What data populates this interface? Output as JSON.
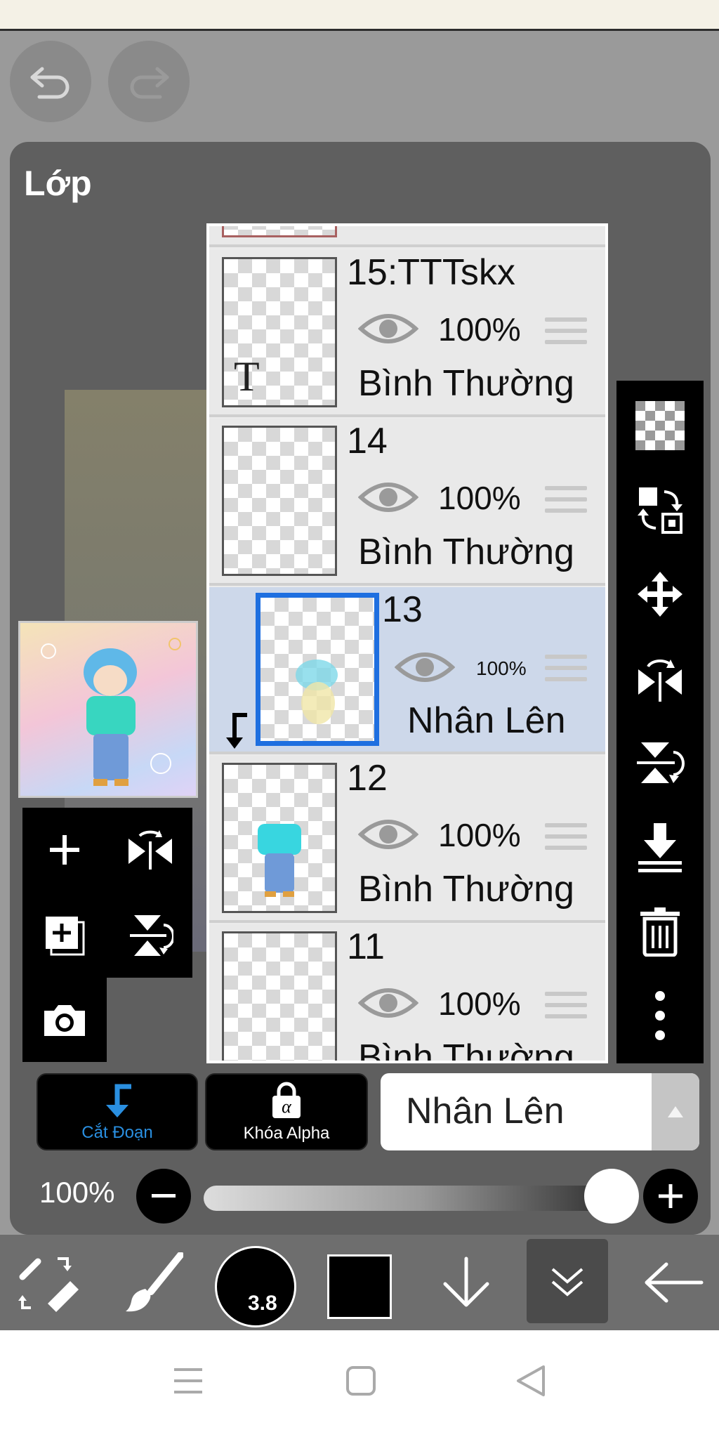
{
  "panel": {
    "title": "Lớp"
  },
  "layers": [
    {
      "name": "15:TTTskx",
      "opacity": "100%",
      "mode": "Bình Thường",
      "text_glyph": "T",
      "selected": false
    },
    {
      "name": "14",
      "opacity": "100%",
      "mode": "Bình Thường",
      "selected": false
    },
    {
      "name": "13",
      "opacity": "100%",
      "mode": "Nhân Lên",
      "selected": true,
      "clipped": true
    },
    {
      "name": "12",
      "opacity": "100%",
      "mode": "Bình Thường",
      "selected": false
    },
    {
      "name": "11",
      "opacity": "100%",
      "mode": "Bình Thường",
      "selected": false
    }
  ],
  "buttons": {
    "clipping": "Cắt Đoạn",
    "alpha_lock": "Khóa Alpha",
    "alpha_symbol": "α"
  },
  "blend_mode": {
    "value": "Nhân Lên"
  },
  "opacity": {
    "label": "100%",
    "value": 1.0
  },
  "brush": {
    "size": "3.8"
  },
  "colors": {
    "accent": "#2a8fe0",
    "selected_layer": "#cdd8ea",
    "selected_border": "#1e6fe0",
    "primary_color": "#000000"
  },
  "icons": {
    "undo": "undo-icon",
    "redo": "redo-icon",
    "add_layer": "plus-icon",
    "flip_horizontal": "flip-horizontal-icon",
    "copy_layer": "copy-layer-icon",
    "flip_vertical": "flip-vertical-icon",
    "camera": "camera-icon",
    "transparency": "checkerboard-icon",
    "swap": "swap-icon",
    "move": "move-icon",
    "merge_down": "merge-down-icon",
    "delete": "trash-icon",
    "more": "more-vertical-icon"
  }
}
